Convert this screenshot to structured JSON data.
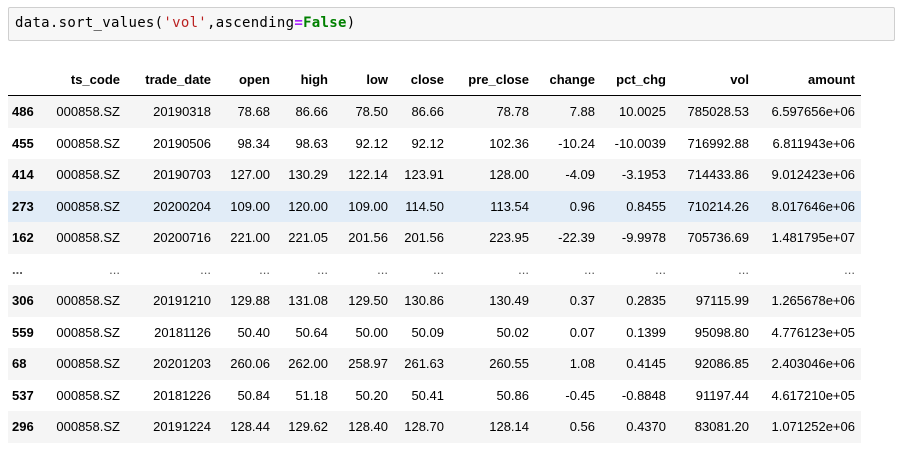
{
  "code": {
    "prefix": "data.sort_values(",
    "string": "'vol'",
    "middle": ",ascending",
    "operator": "=",
    "keyword": "False",
    "suffix": ")"
  },
  "table": {
    "columns": [
      "ts_code",
      "trade_date",
      "open",
      "high",
      "low",
      "close",
      "pre_close",
      "change",
      "pct_chg",
      "vol",
      "amount"
    ],
    "rows": [
      {
        "index": "486",
        "cells": [
          "000858.SZ",
          "20190318",
          "78.68",
          "86.66",
          "78.50",
          "86.66",
          "78.78",
          "7.88",
          "10.0025",
          "785028.53",
          "6.597656e+06"
        ]
      },
      {
        "index": "455",
        "cells": [
          "000858.SZ",
          "20190506",
          "98.34",
          "98.63",
          "92.12",
          "92.12",
          "102.36",
          "-10.24",
          "-10.0039",
          "716992.88",
          "6.811943e+06"
        ]
      },
      {
        "index": "414",
        "cells": [
          "000858.SZ",
          "20190703",
          "127.00",
          "130.29",
          "122.14",
          "123.91",
          "128.00",
          "-4.09",
          "-3.1953",
          "714433.86",
          "9.012423e+06"
        ]
      },
      {
        "index": "273",
        "cells": [
          "000858.SZ",
          "20200204",
          "109.00",
          "120.00",
          "109.00",
          "114.50",
          "113.54",
          "0.96",
          "0.8455",
          "710214.26",
          "8.017646e+06"
        ]
      },
      {
        "index": "162",
        "cells": [
          "000858.SZ",
          "20200716",
          "221.00",
          "221.05",
          "201.56",
          "201.56",
          "223.95",
          "-22.39",
          "-9.9978",
          "705736.69",
          "1.481795e+07"
        ]
      },
      {
        "index": "...",
        "cells": [
          "...",
          "...",
          "...",
          "...",
          "...",
          "...",
          "...",
          "...",
          "...",
          "...",
          "..."
        ]
      },
      {
        "index": "306",
        "cells": [
          "000858.SZ",
          "20191210",
          "129.88",
          "131.08",
          "129.50",
          "130.86",
          "130.49",
          "0.37",
          "0.2835",
          "97115.99",
          "1.265678e+06"
        ]
      },
      {
        "index": "559",
        "cells": [
          "000858.SZ",
          "20181126",
          "50.40",
          "50.64",
          "50.00",
          "50.09",
          "50.02",
          "0.07",
          "0.1399",
          "95098.80",
          "4.776123e+05"
        ]
      },
      {
        "index": "68",
        "cells": [
          "000858.SZ",
          "20201203",
          "260.06",
          "262.00",
          "258.97",
          "261.63",
          "260.55",
          "1.08",
          "0.4145",
          "92086.85",
          "2.403046e+06"
        ]
      },
      {
        "index": "537",
        "cells": [
          "000858.SZ",
          "20181226",
          "50.84",
          "51.18",
          "50.20",
          "50.41",
          "50.86",
          "-0.45",
          "-0.8848",
          "91197.44",
          "4.617210e+05"
        ]
      },
      {
        "index": "296",
        "cells": [
          "000858.SZ",
          "20191224",
          "128.44",
          "129.62",
          "128.40",
          "128.70",
          "128.14",
          "0.56",
          "0.4370",
          "83081.20",
          "1.071252e+06"
        ]
      }
    ],
    "highlighted_row_index": "273",
    "colors": {
      "header_rule": "#000000",
      "stripe": "#f5f5f5",
      "hover": "#e1ecf7"
    }
  }
}
